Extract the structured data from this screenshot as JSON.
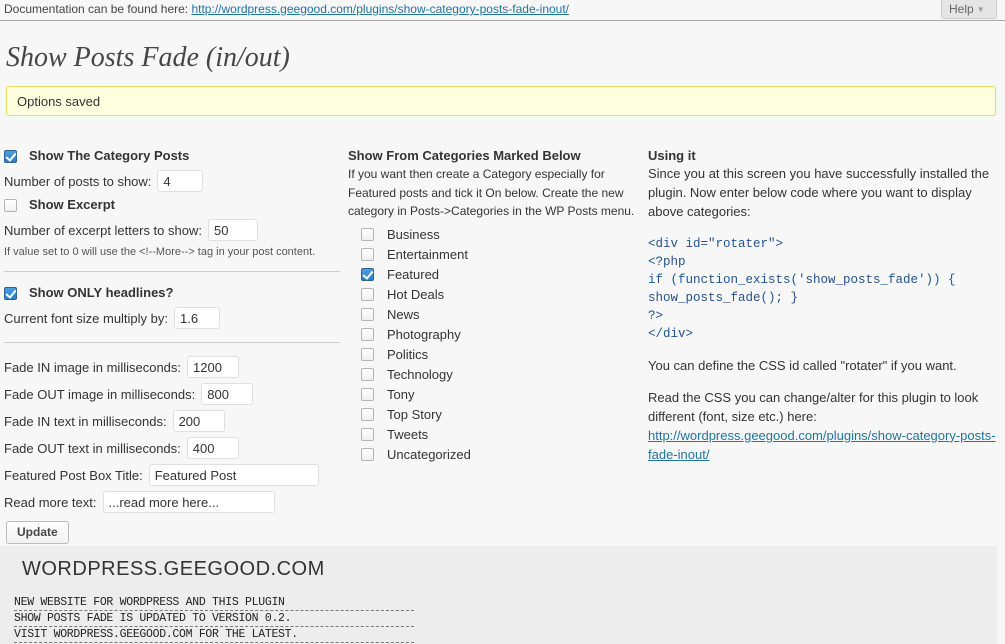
{
  "topbar": {
    "doc_label": "Documentation can be found here:",
    "doc_link": "http://wordpress.geegood.com/plugins/show-category-posts-fade-inout/",
    "help_label": "Help",
    "help_caret": "▼"
  },
  "page": {
    "title": "Show Posts Fade (in/out)",
    "notice": "Options saved"
  },
  "left": {
    "show_category_posts_label": "Show The Category Posts",
    "show_category_posts_checked": true,
    "posts_to_show_label": "Number of posts to show:",
    "posts_to_show_value": "4",
    "show_excerpt_label": "Show Excerpt",
    "show_excerpt_checked": false,
    "excerpt_letters_label": "Number of excerpt letters to show:",
    "excerpt_letters_value": "50",
    "excerpt_hint": "If value set to 0 will use the <!--More--> tag in your post content.",
    "only_headlines_label": "Show ONLY headlines?",
    "only_headlines_checked": true,
    "font_multiply_label": "Current font size multiply by:",
    "font_multiply_value": "1.6",
    "fade_in_image_label": "Fade IN image in milliseconds:",
    "fade_in_image_value": "1200",
    "fade_out_image_label": "Fade OUT image in milliseconds:",
    "fade_out_image_value": "800",
    "fade_in_text_label": "Fade IN text in milliseconds:",
    "fade_in_text_value": "200",
    "fade_out_text_label": "Fade OUT text in milliseconds:",
    "fade_out_text_value": "400",
    "featured_box_title_label": "Featured Post Box Title:",
    "featured_box_title_value": "Featured Post",
    "read_more_label": "Read more text:",
    "read_more_value": "...read more here...",
    "update_button": "Update"
  },
  "categories_panel": {
    "heading": "Show From Categories Marked Below",
    "description": "If you want then create a Category especially for Featured posts and tick it On below. Create the new category in Posts->Categories in the WP Posts menu.",
    "items": [
      {
        "label": "Business",
        "checked": false
      },
      {
        "label": "Entertainment",
        "checked": false
      },
      {
        "label": "Featured",
        "checked": true
      },
      {
        "label": "Hot Deals",
        "checked": false
      },
      {
        "label": "News",
        "checked": false
      },
      {
        "label": "Photography",
        "checked": false
      },
      {
        "label": "Politics",
        "checked": false
      },
      {
        "label": "Technology",
        "checked": false
      },
      {
        "label": "Tony",
        "checked": false
      },
      {
        "label": "Top Story",
        "checked": false
      },
      {
        "label": "Tweets",
        "checked": false
      },
      {
        "label": "Uncategorized",
        "checked": false
      }
    ]
  },
  "using_it": {
    "heading": "Using it",
    "intro": "Since you at this screen you have successfully installed the plugin. Now enter below code where you want to display above categories:",
    "code": "<div id=\"rotater\">\n<?php\nif (function_exists('show_posts_fade')) {\nshow_posts_fade(); }\n?>\n</div>",
    "css_note": "You can define the CSS id called \"rotater\" if you want.",
    "read_css_note": "Read the CSS you can change/alter for this plugin to look different (font, size etc.) here:",
    "css_link": "http://wordpress.geegood.com/plugins/show-category-posts-fade-inout/"
  },
  "footer": {
    "title": "WORDPRESS.GEEGOOD.COM",
    "lines": [
      "NEW WEBSITE FOR WORDPRESS AND THIS PLUGIN",
      "SHOW POSTS FADE IS UPDATED TO VERSION 0.2.",
      "VISIT WORDPRESS.GEEGOOD.COM FOR THE LATEST."
    ]
  },
  "colors": {
    "link": "#21759b",
    "notice_bg": "#ffffe0",
    "notice_border": "#e6db55",
    "code_text": "#21548e",
    "checkbox_checked": "#2a7fc9",
    "footer_bg": "#ededed"
  }
}
